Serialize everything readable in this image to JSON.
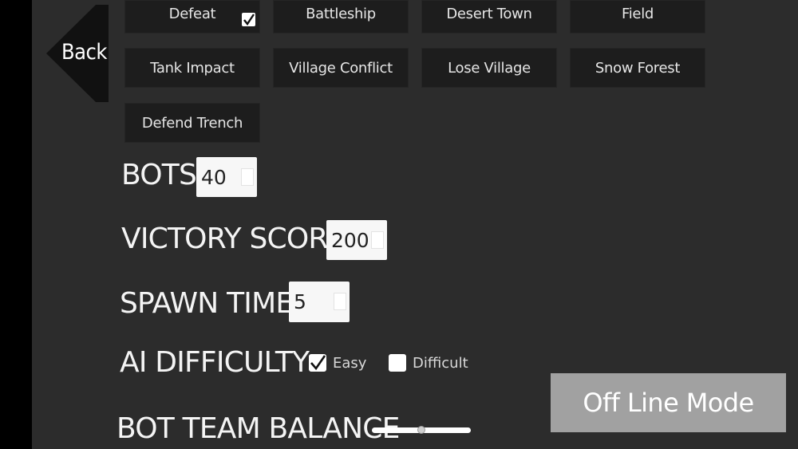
{
  "back": {
    "label": "Back"
  },
  "maps": [
    {
      "label": "Defeat",
      "checked": true
    },
    {
      "label": "Battleship"
    },
    {
      "label": "Desert Town"
    },
    {
      "label": "Field"
    },
    {
      "label": "Tank Impact"
    },
    {
      "label": "Village Conflict"
    },
    {
      "label": "Lose Village"
    },
    {
      "label": "Snow Forest"
    },
    {
      "label": "Defend Trench"
    }
  ],
  "settings": {
    "bots": {
      "label": "BOTS",
      "value": "40"
    },
    "victory_score": {
      "label": "VICTORY SCORE",
      "value": "200"
    },
    "spawn_time": {
      "label": "SPAWN TIME",
      "value": "5"
    },
    "ai_difficulty": {
      "label": "AI DIFFICULTY",
      "options": [
        {
          "label": "Easy",
          "checked": true
        },
        {
          "label": "Difficult",
          "checked": false
        }
      ]
    },
    "bot_team_balance": {
      "label": "BOT TEAM BALANCE",
      "level": 0.5
    }
  },
  "offline_button": {
    "label": "Off Line Mode"
  },
  "colors": {
    "panel": "#2c2c2c",
    "map_button": "#1d1d1d",
    "offline_button": "#a1a1a1"
  }
}
